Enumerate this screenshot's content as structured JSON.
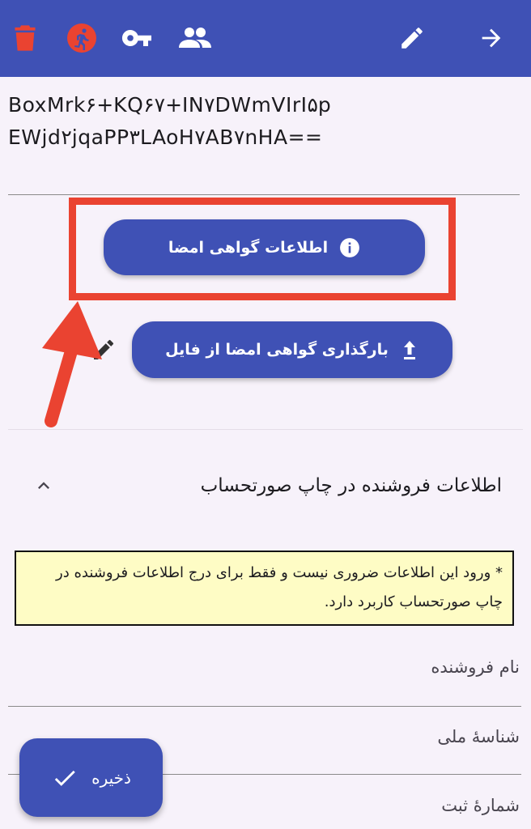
{
  "toolbar": {
    "actions": [
      "delete-icon",
      "exit-icon",
      "key-icon",
      "group-icon",
      "edit-icon",
      "forward-arrow-icon"
    ],
    "colors": {
      "bar": "#3f51b5",
      "delete": "#ea4331"
    }
  },
  "certificate": {
    "line1": "BoxMrk۶+KQ۶۷+IN۷DWmVIrI۵p",
    "line2": "EWjd۲jqaPP۳LAoH۷AB۷nHA=="
  },
  "buttons": {
    "cert_info_label": "اطلاعات گواهی امضا",
    "upload_label": "بارگذاری گواهی امضا از فایل"
  },
  "seller_section": {
    "title": "اطلاعات فروشنده در چاپ صورتحساب",
    "notice": "* ورود این اطلاعات ضروری نیست و فقط برای درج اطلاعات فروشنده در چاپ صورتحساب کاربرد دارد.",
    "fields": {
      "seller_name": "نام فروشنده",
      "national_id": "شناسهٔ ملی",
      "registration_number": "شمارهٔ ثبت"
    }
  },
  "fab": {
    "label": "ذخیره"
  },
  "annotation_color": "#ea4331"
}
